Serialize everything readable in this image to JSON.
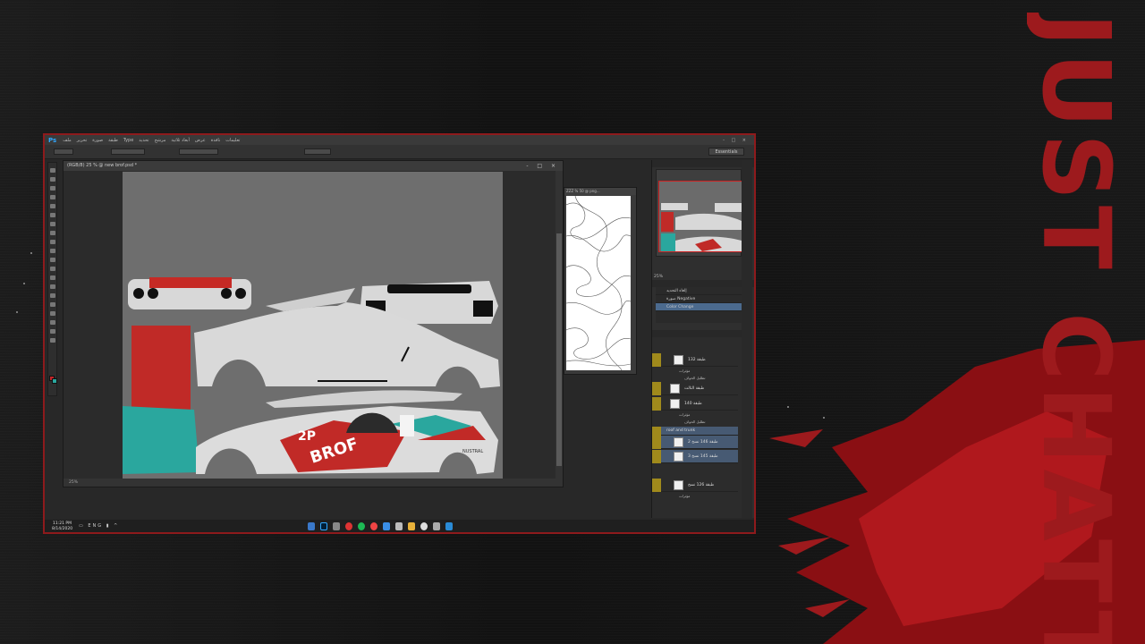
{
  "branding": {
    "watermark": "JUST CHATTIN"
  },
  "photoshop": {
    "app_logo": "Ps",
    "menu": [
      "ملف",
      "تحرير",
      "صورة",
      "طبقة",
      "Type",
      "تحديد",
      "مرشح",
      "أبعاد ثلاثية",
      "عرض",
      "نافذة",
      "تعليمات"
    ],
    "window_controls": "- □ ×",
    "workspace": "Essentials",
    "document_title": "(RGB/8) 25 % @ new brof.psd *",
    "document_controls": "- □ ×",
    "zoom": "25%",
    "pattern_doc_title": "ZZZ % 50 @ png...",
    "navigator_zoom": "25%",
    "history_items": [
      {
        "label": "إلغاء التحديد",
        "active": false
      },
      {
        "label": "صورة Negative",
        "active": false
      },
      {
        "label": "Color Change",
        "active": true
      }
    ],
    "layers": [
      {
        "name": "طبقة 132",
        "selected": false
      },
      {
        "name": "طبقة الثالث",
        "selected": false
      },
      {
        "name": "طبقة 140",
        "selected": false
      },
      {
        "name": "roof and trunk",
        "selected": true
      },
      {
        "name": "طبقة 146 نسخ 2",
        "selected": true
      },
      {
        "name": "طبقة 145 نسخ 3",
        "selected": true
      },
      {
        "name": "طبقة 126 نسخ",
        "selected": false
      }
    ],
    "layer_sub_items": [
      "مؤثرات",
      "تظليل الحواف",
      "مؤثرات",
      "تظليل الحواف",
      "مؤثرات"
    ],
    "livery": {
      "race_number": "2P",
      "logo": "BROF",
      "sponsor": "NUSTRAL"
    }
  },
  "taskbar": {
    "time": "11:21 PM",
    "date": "8/14/2020",
    "language": "ENG"
  },
  "colors": {
    "accent_red": "#c2262a",
    "teal": "#2aa79e",
    "frame": "#8e1a1c"
  }
}
